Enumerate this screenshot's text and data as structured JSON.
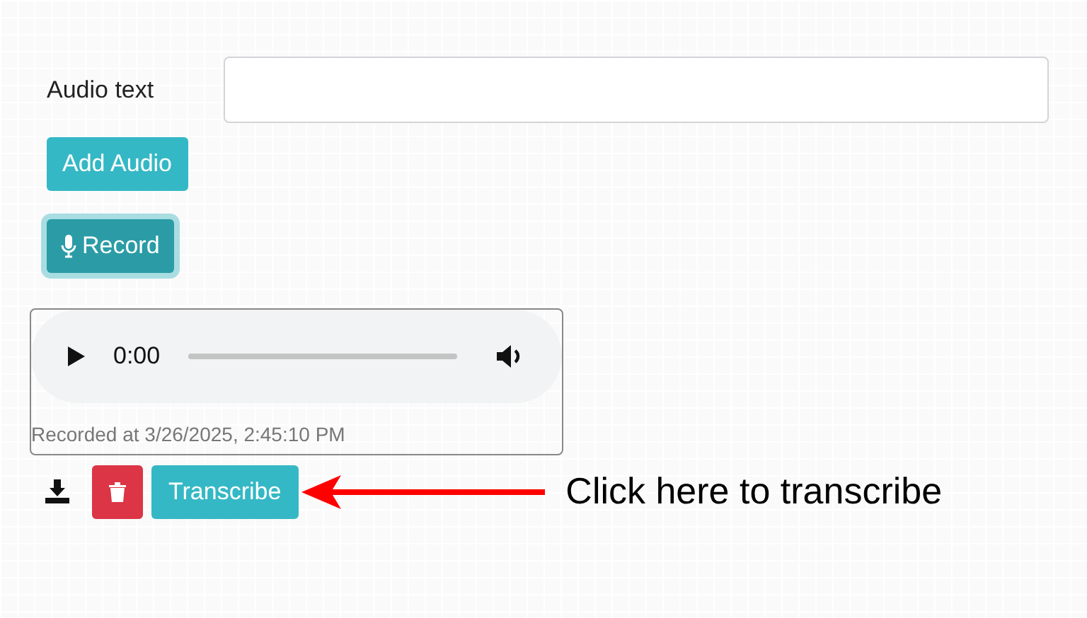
{
  "form": {
    "label": "Audio text",
    "add_button": "Add Audio",
    "record_button": "Record",
    "record_focused": true
  },
  "recording": {
    "time": "0:00",
    "level": 0,
    "caption": "Recorded at 3/26/2025, 2:45:10 PM",
    "transcribe_button": "Transcribe"
  },
  "annotation": {
    "text": "Click here to transcribe"
  }
}
